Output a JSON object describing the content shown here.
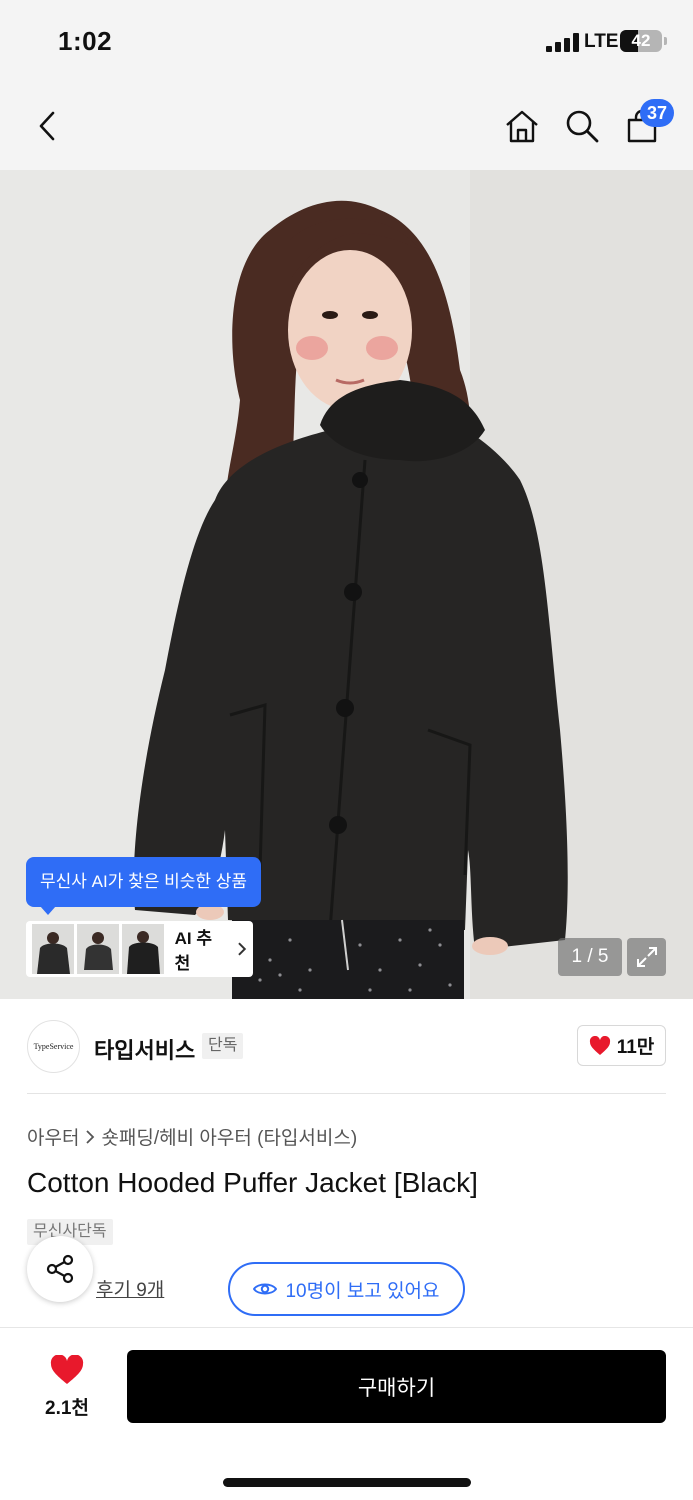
{
  "status_bar": {
    "time": "1:02",
    "network": "LTE",
    "battery": "42",
    "battery_level": 0.42
  },
  "nav": {
    "cart_count": "37",
    "icons": [
      "back-icon",
      "home-icon",
      "search-icon",
      "cart-icon"
    ]
  },
  "hero": {
    "ai_tooltip": "무신사 AI가 찾은 비슷한 상품",
    "ai_button": "AI 추천",
    "counter": "1 / 5",
    "background": "#e9e9e7",
    "jacket_color": "#262524"
  },
  "brand": {
    "logo_text": "TypeService",
    "name": "타입서비스",
    "tag": "단독",
    "fav_count": "11만"
  },
  "product": {
    "breadcrumb_category": "아우터",
    "breadcrumb_subcategory": "숏패딩/헤비 아우터 (타입서비스)",
    "title": "Cotton Hooded Puffer Jacket [Black]",
    "exclusive_tag": "무신사단독",
    "reviews": "후기 9개",
    "viewing": "10명이 보고 있어요"
  },
  "bottom_bar": {
    "like_count": "2.1천",
    "buy_label": "구매하기"
  },
  "colors": {
    "accent": "#2f6df6",
    "heart": "#e8192c",
    "buy_button": "#000000"
  }
}
